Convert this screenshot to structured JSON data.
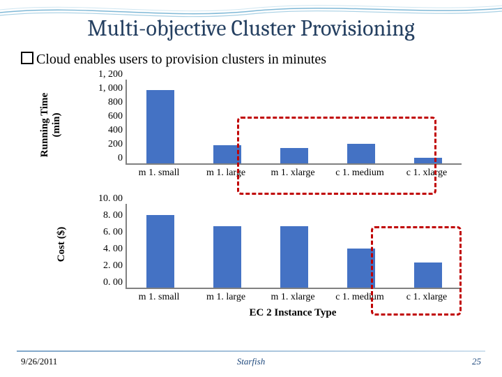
{
  "title": "Multi-objective Cluster Provisioning",
  "bullet": "Cloud enables users to provision clusters in minutes",
  "footer": {
    "date": "9/26/2011",
    "center": "Starfish",
    "page": "25"
  },
  "chart_data": [
    {
      "type": "bar",
      "title": "",
      "ylabel": "Running Time\n(min)",
      "ylim": [
        0,
        1200
      ],
      "yticks": [
        "1, 200",
        "1, 000",
        "800",
        "600",
        "400",
        "200",
        "0"
      ],
      "categories": [
        "m 1. small",
        "m 1. large",
        "m 1. xlarge",
        "c 1. medium",
        "c 1. xlarge"
      ],
      "values": [
        1050,
        260,
        220,
        280,
        80
      ]
    },
    {
      "type": "bar",
      "title": "",
      "ylabel": "Cost ($)",
      "xlabel": "EC 2 Instance Type",
      "ylim": [
        0,
        10
      ],
      "yticks": [
        "10. 00",
        "8. 00",
        "6. 00",
        "4. 00",
        "2. 00",
        "0. 00"
      ],
      "categories": [
        "m 1. small",
        "m 1. large",
        "m 1. xlarge",
        "c 1. medium",
        "c 1. xlarge"
      ],
      "values": [
        8.7,
        7.3,
        7.3,
        4.7,
        3.0
      ]
    }
  ]
}
